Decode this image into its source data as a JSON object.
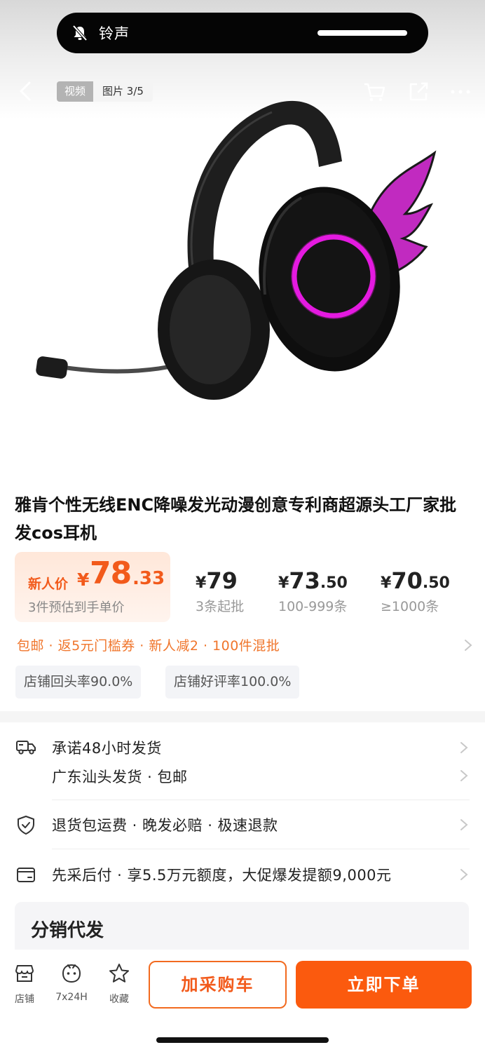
{
  "status": {
    "ring_label": "铃声"
  },
  "gallery": {
    "tab_video": "视频",
    "tab_images": "图片 3/5"
  },
  "product": {
    "title": "雅肯个性无线ENC降噪发光动漫创意专利商超源头工厂家批发cos耳机",
    "image_description_icon": "headset-image"
  },
  "price": {
    "new_user_label": "新人价",
    "currency": "¥",
    "integer": "78",
    "decimal": ".33",
    "note": "3件预估到手单价",
    "tiers": [
      {
        "currency": "¥",
        "integer": "79",
        "decimal": "",
        "quantity": "3条起批"
      },
      {
        "currency": "¥",
        "integer": "73",
        "decimal": ".50",
        "quantity": "100-999条"
      },
      {
        "currency": "¥",
        "integer": "70",
        "decimal": ".50",
        "quantity": "≥1000条"
      }
    ]
  },
  "promo": {
    "text": "包邮 · 返5元门槛券 · 新人减2 · 100件混批"
  },
  "badges": [
    "店铺回头率90.0%",
    "店铺好评率100.0%"
  ],
  "services": {
    "shipping_promise": "承诺48小时发货",
    "shipping_origin": "广东汕头发货 · 包邮",
    "returns": "退货包运费 · 晚发必赔 · 极速退款",
    "pay_later": "先采后付 · 享5.5万元额度，大促爆发提额9,000元"
  },
  "distribution": {
    "heading": "分销代发"
  },
  "bottom_bar": {
    "store": "店铺",
    "service": "7x24H",
    "favorite": "收藏",
    "add_to_cart": "加采购车",
    "buy_now": "立即下单"
  },
  "colors": {
    "accent": "#fb5a0e",
    "price_orange": "#f25a1b",
    "promo_orange": "#f0752b",
    "headset_glow": "#e41ae0"
  }
}
